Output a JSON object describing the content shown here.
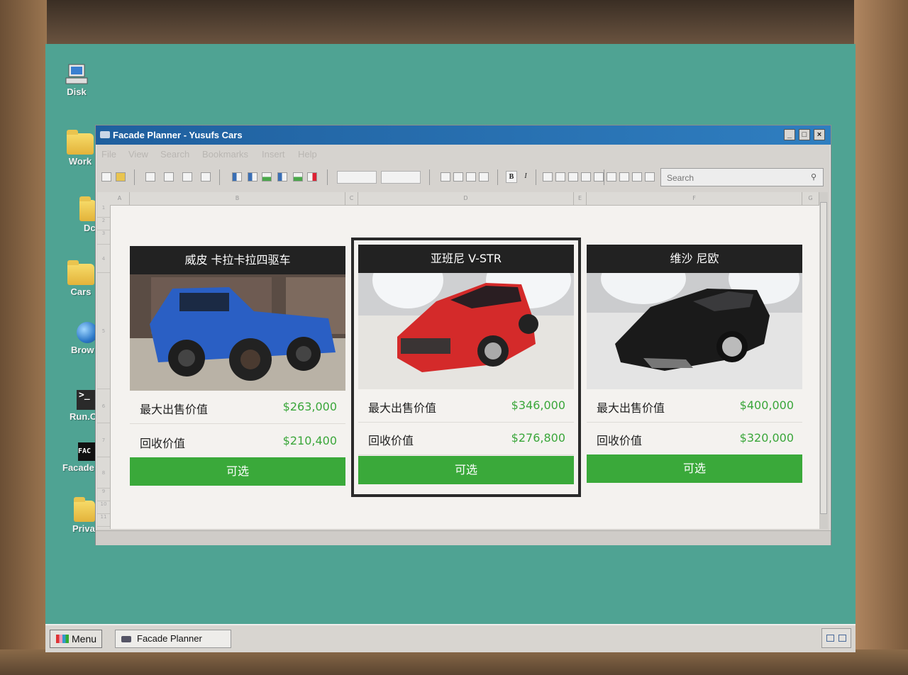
{
  "desktop": {
    "icons": [
      {
        "label": "Disk",
        "icon": "computer-icon"
      },
      {
        "label": "Work",
        "icon": "folder-icon"
      },
      {
        "label": "Dc",
        "icon": "folder-icon"
      },
      {
        "label": "Cars",
        "icon": "folder-icon"
      },
      {
        "label": "Brow",
        "icon": "globe-icon"
      },
      {
        "label": "Run.C",
        "icon": "terminal-icon"
      },
      {
        "label": "Facade",
        "icon": "facade-icon"
      },
      {
        "label": "Priva",
        "icon": "folder-icon"
      }
    ],
    "terminal_glyph": ">_",
    "facade_glyph": "FAC"
  },
  "window": {
    "title": "Facade Planner - Yusufs Cars",
    "controls": {
      "minimize": "_",
      "maximize": "□",
      "close": "×"
    },
    "menu": [
      "File",
      "View",
      "Search",
      "Bookmarks",
      "Insert",
      "Help"
    ],
    "toolbar": {
      "bold": "B",
      "italic": "I",
      "search_placeholder": "Search"
    },
    "columns": [
      "A",
      "B",
      "C",
      "D",
      "E",
      "F",
      "G"
    ],
    "rows": [
      "1",
      "2",
      "3",
      "4",
      "5",
      "6",
      "7",
      "8",
      "9",
      "10",
      "11"
    ]
  },
  "cars": [
    {
      "name": "威皮 卡拉卡拉四驱车",
      "max_sale_label": "最大出售价值",
      "max_sale_value": "$263,000",
      "trade_label": "回收价值",
      "trade_value": "$210,400",
      "status": "可选",
      "color": "#2a5fc4",
      "selected": false
    },
    {
      "name": "亚班尼 V-STR",
      "max_sale_label": "最大出售价值",
      "max_sale_value": "$346,000",
      "trade_label": "回收价值",
      "trade_value": "$276,800",
      "status": "可选",
      "color": "#d42a2a",
      "selected": true
    },
    {
      "name": "维沙 尼欧",
      "max_sale_label": "最大出售价值",
      "max_sale_value": "$400,000",
      "trade_label": "回收价值",
      "trade_value": "$320,000",
      "status": "可选",
      "color": "#1a1a1a",
      "selected": false
    }
  ],
  "taskbar": {
    "menu_label": "Menu",
    "task_label": "Facade Planner"
  },
  "colors": {
    "desktop": "#4fa393",
    "titlebar": "#2a6fb0",
    "available_green": "#3aa93a",
    "price_green": "#3aa63a",
    "card_header": "#222222"
  }
}
